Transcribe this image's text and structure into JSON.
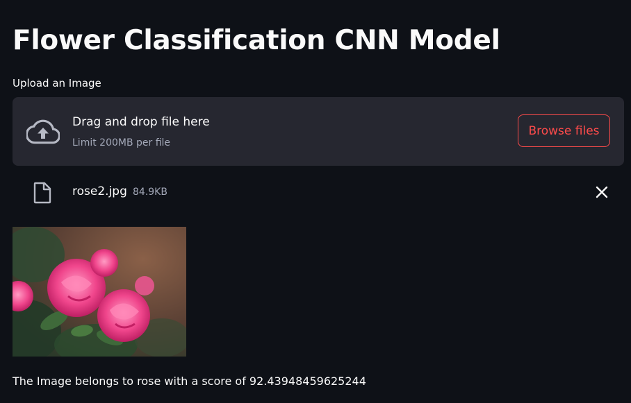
{
  "page": {
    "title": "Flower Classification CNN Model"
  },
  "uploader": {
    "label": "Upload an Image",
    "drop_text": "Drag and drop file here",
    "limit_text": "Limit 200MB per file",
    "browse_label": "Browse files",
    "icon": "cloud-upload-icon"
  },
  "file": {
    "name": "rose2.jpg",
    "size": "84.9KB",
    "icon": "file-icon",
    "remove_icon": "close-icon"
  },
  "result": {
    "text": "The Image belongs to rose with a score of 92.43948459625244"
  },
  "colors": {
    "background": "#0e1117",
    "panel": "#262730",
    "accent": "#ff4b4b",
    "text": "#fafafa",
    "muted": "#a3a8b8"
  }
}
